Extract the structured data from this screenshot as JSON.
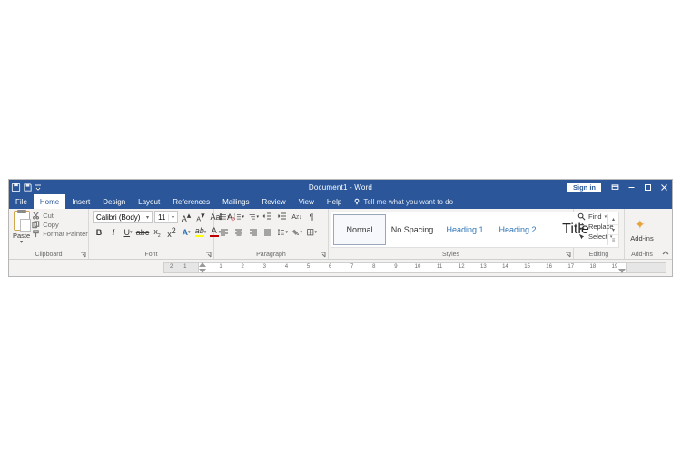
{
  "titlebar": {
    "doc_title": "Document1 - Word",
    "signin": "Sign in"
  },
  "tabs": {
    "items": [
      "File",
      "Home",
      "Insert",
      "Design",
      "Layout",
      "References",
      "Mailings",
      "Review",
      "View",
      "Help"
    ],
    "active_index": 1,
    "tell_me_placeholder": "Tell me what you want to do"
  },
  "clipboard": {
    "group_label": "Clipboard",
    "paste": "Paste",
    "cut": "Cut",
    "copy": "Copy",
    "format_painter": "Format Painter"
  },
  "font": {
    "group_label": "Font",
    "font_name": "Calibri (Body)",
    "font_size": "11",
    "highlight_color": "#ffff00",
    "font_color": "#c00000"
  },
  "paragraph": {
    "group_label": "Paragraph"
  },
  "styles": {
    "group_label": "Styles",
    "items": [
      {
        "label": "Normal",
        "kind": "normal",
        "selected": true
      },
      {
        "label": "No Spacing",
        "kind": "normal",
        "selected": false
      },
      {
        "label": "Heading 1",
        "kind": "heading",
        "selected": false
      },
      {
        "label": "Heading 2",
        "kind": "heading",
        "selected": false
      },
      {
        "label": "Title",
        "kind": "title",
        "selected": false
      }
    ]
  },
  "editing": {
    "group_label": "Editing",
    "find": "Find",
    "replace": "Replace",
    "select": "Select"
  },
  "addins": {
    "group_label": "Add-ins",
    "label": "Add-ins"
  },
  "ruler": {
    "labels_neg": [
      "2",
      "1"
    ],
    "labels_pos": [
      "1",
      "2",
      "3",
      "4",
      "5",
      "6",
      "7",
      "8",
      "9",
      "10",
      "11",
      "12",
      "13",
      "14",
      "15",
      "16",
      "17",
      "18",
      "19"
    ]
  }
}
